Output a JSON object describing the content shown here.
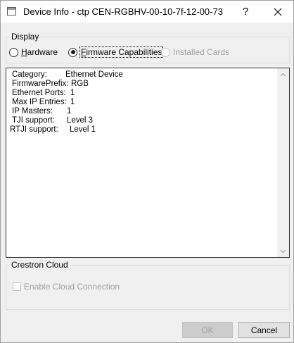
{
  "window": {
    "title": "Device Info - ctp CEN-RGBHV-00-10-7f-12-00-73",
    "help_label": "?",
    "icons": {
      "app": "window-icon",
      "close": "close-icon"
    }
  },
  "display": {
    "group_label": "Display",
    "options": [
      {
        "accel": "H",
        "rest": "ardware",
        "checked": false,
        "enabled": true
      },
      {
        "accel": "F",
        "rest": "irmware Capabilities",
        "checked": true,
        "enabled": true
      },
      {
        "label": "Installed Cards",
        "checked": false,
        "enabled": false
      }
    ]
  },
  "info": {
    "lines": [
      {
        "key": "Category:",
        "value": "Ethernet Device"
      },
      {
        "key": "FirmwarePrefix:",
        "value": "RGB"
      },
      {
        "key": "Ethernet Ports:",
        "value": "1"
      },
      {
        "key": "Max IP Entries:",
        "value": "1"
      },
      {
        "key": "IP Masters:",
        "value": "1"
      },
      {
        "key": "TJI support:",
        "value": "Level 3"
      },
      {
        "key": "RTJI support:",
        "value": "Level 1"
      }
    ]
  },
  "cloud": {
    "group_label": "Crestron Cloud",
    "checkbox_label": "Enable Cloud Connection",
    "checkbox_checked": false,
    "checkbox_enabled": false
  },
  "buttons": {
    "ok_label": "OK",
    "cancel_label": "Cancel"
  }
}
